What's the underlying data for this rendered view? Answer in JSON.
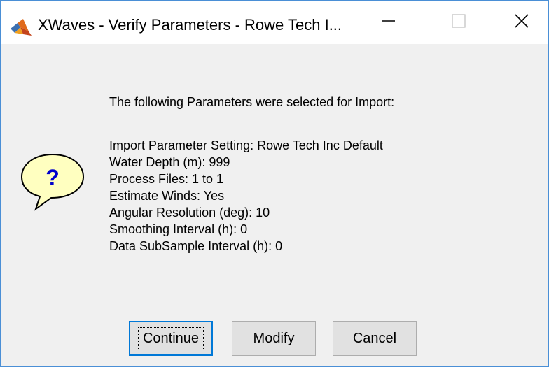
{
  "window": {
    "title": "XWaves - Verify Parameters - Rowe Tech I...",
    "icons": {
      "app": "matlab-icon",
      "minimize": "minimize-icon",
      "maximize": "maximize-icon",
      "close": "close-icon"
    }
  },
  "dialog": {
    "icon": "question-icon",
    "icon_glyph": "?",
    "headline": "The following Parameters were selected for Import:",
    "params": [
      "Import Parameter Setting: Rowe Tech Inc Default",
      "Water Depth (m): 999",
      "Process Files: 1 to 1",
      "Estimate Winds: Yes",
      "Angular Resolution (deg): 10",
      "Smoothing Interval (h): 0",
      "Data SubSample Interval (h): 0"
    ]
  },
  "buttons": {
    "continue": "Continue",
    "modify": "Modify",
    "cancel": "Cancel"
  },
  "colors": {
    "window_border": "#4a8fd6",
    "focus_border": "#0078d7",
    "bubble_fill": "#ffffc0",
    "question_mark": "#0000cc"
  }
}
